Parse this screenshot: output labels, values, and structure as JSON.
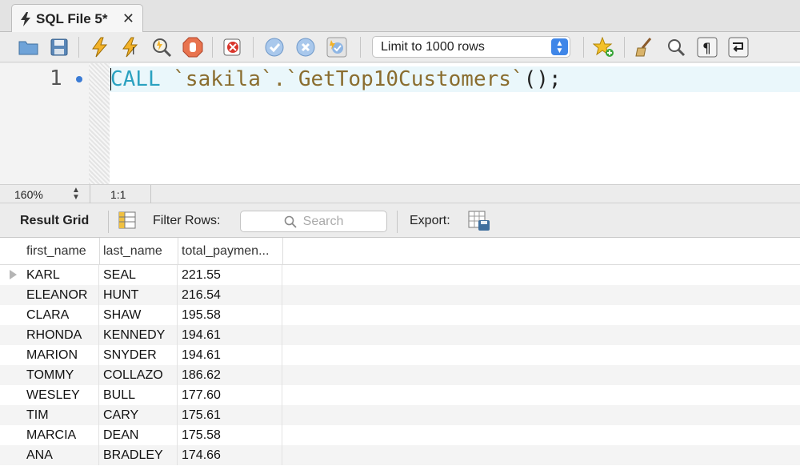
{
  "tab": {
    "title": "SQL File 5*",
    "close_glyph": "✕"
  },
  "toolbar": {
    "icons": [
      "open-folder-icon",
      "save-icon",
      "execute-icon",
      "execute-current-icon",
      "explain-icon",
      "stop-icon",
      "toggle-error-icon",
      "commit-icon",
      "rollback-icon",
      "autocommit-icon",
      "add-snippet-icon",
      "beautify-icon",
      "find-icon",
      "invisible-chars-icon",
      "wrap-lines-icon"
    ],
    "limit_select": "Limit to 1000 rows"
  },
  "editor": {
    "line_number": "1",
    "code": {
      "keyword": "CALL",
      "identifier": "`sakila`.`GetTop10Customers`",
      "tail": "();"
    },
    "colors": {
      "keyword": "#2aa1c0",
      "identifier": "#8a6d2f"
    }
  },
  "status": {
    "zoom": "160%",
    "position": "1:1"
  },
  "results_bar": {
    "result_grid_label": "Result Grid",
    "filter_rows_label": "Filter Rows:",
    "search_placeholder": "Search",
    "export_label": "Export:"
  },
  "grid": {
    "columns": [
      "first_name",
      "last_name",
      "total_paymen..."
    ],
    "rows": [
      [
        "KARL",
        "SEAL",
        "221.55"
      ],
      [
        "ELEANOR",
        "HUNT",
        "216.54"
      ],
      [
        "CLARA",
        "SHAW",
        "195.58"
      ],
      [
        "RHONDA",
        "KENNEDY",
        "194.61"
      ],
      [
        "MARION",
        "SNYDER",
        "194.61"
      ],
      [
        "TOMMY",
        "COLLAZO",
        "186.62"
      ],
      [
        "WESLEY",
        "BULL",
        "177.60"
      ],
      [
        "TIM",
        "CARY",
        "175.61"
      ],
      [
        "MARCIA",
        "DEAN",
        "175.58"
      ],
      [
        "ANA",
        "BRADLEY",
        "174.66"
      ]
    ]
  }
}
